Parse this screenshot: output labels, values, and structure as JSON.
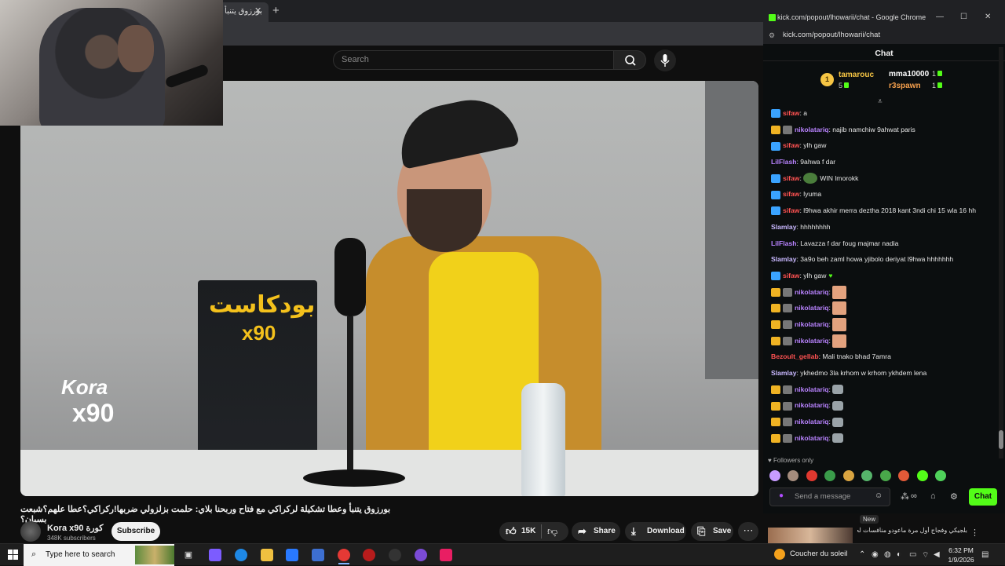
{
  "youtube": {
    "tab_title": "بورزوق يتنبأ",
    "search_placeholder": "Search",
    "video_title": "بورزوق يتنبأ وعطا تشكيلة لركراكي مع فتاح وربحنا بلاي: حلمت بزلزولي ضربها!ركراكي؟عطا علهم؟شبعت بسبان؟",
    "overlay": {
      "logo_text": "Kora",
      "logo_sub": "x90",
      "poster_title": "بودكاست",
      "poster_sub": "x90"
    },
    "channel": {
      "name": "Kora x90 كورة",
      "subscribers": "348K subscribers"
    },
    "subscribe_label": "Subscribe",
    "actions": {
      "likes": "15K",
      "share": "Share",
      "download": "Download",
      "save": "Save"
    }
  },
  "kick": {
    "window_title": "kick.com/popout/lhowarii/chat - Google Chrome",
    "url": "kick.com/popout/lhowarii/chat",
    "header": "Chat",
    "top_gifters": [
      {
        "name": "tamarouc",
        "count": "5",
        "color": "#f6c544"
      },
      {
        "name": "mma10000",
        "count": "1",
        "color": "#ffffff"
      },
      {
        "name": "r3spawn",
        "count": "1",
        "color": "#f6a04d"
      }
    ],
    "rank": "1",
    "messages": [
      {
        "user": "sifaw",
        "color": "#ff5252",
        "badges": [
          "blue"
        ],
        "text": "a"
      },
      {
        "user": "nikolatariq",
        "color": "#b983ff",
        "badges": [
          "gold",
          "grey"
        ],
        "text": "najib namchiw 9ahwat paris"
      },
      {
        "user": "sifaw",
        "color": "#ff5252",
        "badges": [
          "blue"
        ],
        "text": "ylh gaw"
      },
      {
        "user": "LilFlash",
        "color": "#b983ff",
        "badges": [],
        "text": "9ahwa f dar"
      },
      {
        "user": "sifaw",
        "color": "#ff5252",
        "badges": [
          "blue"
        ],
        "text": "WIN lmorokk",
        "emote": "pepe"
      },
      {
        "user": "sifaw",
        "color": "#ff5252",
        "badges": [
          "blue"
        ],
        "text": "lyuma"
      },
      {
        "user": "sifaw",
        "color": "#ff5252",
        "badges": [
          "blue"
        ],
        "text": "l9hwa akhir merra deztha 2018 kant 3ndi chi 15 wla 16 hh"
      },
      {
        "user": "Slamlay",
        "color": "#c9b8ff",
        "badges": [],
        "text": "hhhhhhhh"
      },
      {
        "user": "LilFlash",
        "color": "#b983ff",
        "badges": [],
        "text": "Lavazza f dar foug majmar nadia"
      },
      {
        "user": "Slamlay",
        "color": "#c9b8ff",
        "badges": [],
        "text": "3a9o beh zaml howa yjibolo deriyat l9hwa hhhhhhh"
      },
      {
        "user": "sifaw",
        "color": "#ff5252",
        "badges": [
          "blue"
        ],
        "text": "ylh gaw",
        "heart": "♥"
      },
      {
        "user": "nikolatariq",
        "color": "#b983ff",
        "badges": [
          "gold",
          "grey"
        ],
        "text": "",
        "emote": "face"
      },
      {
        "user": "nikolatariq",
        "color": "#b983ff",
        "badges": [
          "gold",
          "grey"
        ],
        "text": "",
        "emote": "face"
      },
      {
        "user": "nikolatariq",
        "color": "#b983ff",
        "badges": [
          "gold",
          "grey"
        ],
        "text": "",
        "emote": "face"
      },
      {
        "user": "nikolatariq",
        "color": "#b983ff",
        "badges": [
          "gold",
          "grey"
        ],
        "text": "",
        "emote": "face"
      },
      {
        "user": "Bezoult_gellab",
        "color": "#ff5252",
        "badges": [],
        "text": "Mali tnako bhad 7amra"
      },
      {
        "user": "Slamlay",
        "color": "#c9b8ff",
        "badges": [],
        "text": "ykhedmo 3la krhom w krhom ykhdem lena"
      },
      {
        "user": "nikolatariq",
        "color": "#b983ff",
        "badges": [
          "gold",
          "grey"
        ],
        "text": "",
        "emote": "small"
      },
      {
        "user": "nikolatariq",
        "color": "#b983ff",
        "badges": [
          "gold",
          "grey"
        ],
        "text": "",
        "emote": "small"
      },
      {
        "user": "nikolatariq",
        "color": "#b983ff",
        "badges": [
          "gold",
          "grey"
        ],
        "text": "",
        "emote": "small"
      },
      {
        "user": "nikolatariq",
        "color": "#b983ff",
        "badges": [
          "gold",
          "grey"
        ],
        "text": "",
        "emote": "small"
      }
    ],
    "followers_only": "♥ Followers only",
    "input_placeholder": "Send a message",
    "chat_button": "Chat",
    "news": {
      "badge": "New",
      "text": "بلجيكي وفجاج أول مرة ماعودو منافسات لحريك"
    }
  },
  "taskbar": {
    "search_placeholder": "Type here to search",
    "weather": "Coucher du soleil",
    "time": "6:32 PM",
    "date": "1/9/2026"
  }
}
